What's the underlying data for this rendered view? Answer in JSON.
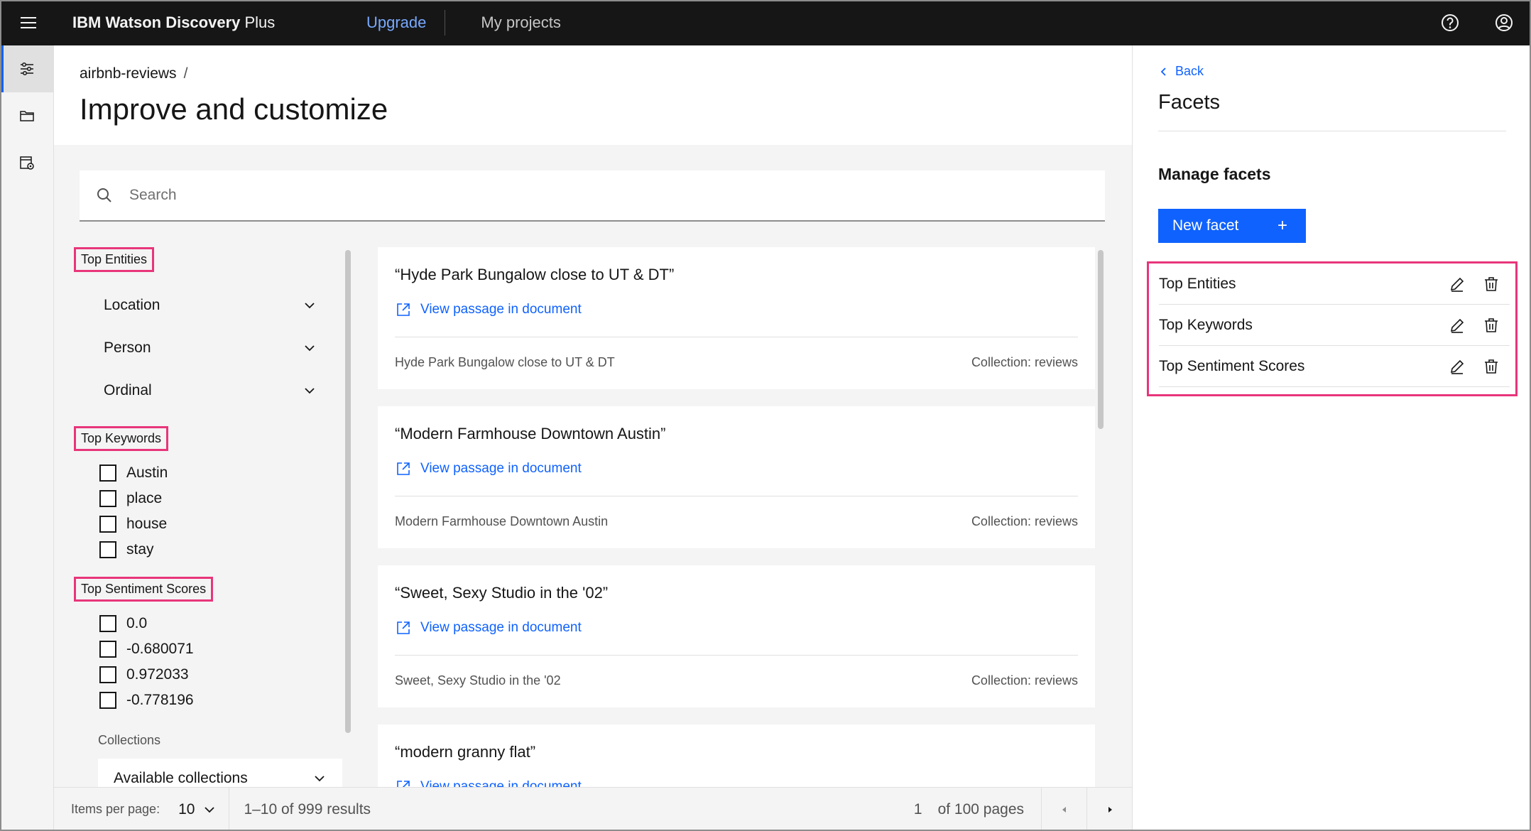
{
  "header": {
    "brand_bold": "IBM",
    "brand_rest": "Watson Discovery",
    "brand_plan": "Plus",
    "upgrade": "Upgrade",
    "my_projects": "My projects"
  },
  "page": {
    "breadcrumb": "airbnb-reviews",
    "breadcrumb_sep": "/",
    "title": "Improve and customize"
  },
  "search": {
    "placeholder": "Search"
  },
  "facets": {
    "top_entities": {
      "heading": "Top Entities",
      "dropdowns": [
        "Location",
        "Person",
        "Ordinal"
      ]
    },
    "top_keywords": {
      "heading": "Top Keywords",
      "options": [
        "Austin",
        "place",
        "house",
        "stay"
      ]
    },
    "top_sentiment": {
      "heading": "Top Sentiment Scores",
      "options": [
        "0.0",
        "-0.680071",
        "0.972033",
        "-0.778196"
      ]
    },
    "collections": {
      "label": "Collections",
      "select": "Available collections"
    }
  },
  "results": [
    {
      "title": "“Hyde Park Bungalow close to UT & DT”",
      "link": "View passage in document",
      "snippet": "Hyde Park Bungalow close to UT & DT",
      "collection": "Collection: reviews"
    },
    {
      "title": "“Modern Farmhouse Downtown Austin”",
      "link": "View passage in document",
      "snippet": "Modern Farmhouse Downtown Austin",
      "collection": "Collection: reviews"
    },
    {
      "title": "“Sweet, Sexy Studio in the '02”",
      "link": "View passage in document",
      "snippet": "Sweet, Sexy Studio in the '02",
      "collection": "Collection: reviews"
    },
    {
      "title": "“modern granny flat”",
      "link": "View passage in document",
      "snippet": "",
      "collection": ""
    }
  ],
  "pagination": {
    "items_label": "Items per page:",
    "items_value": "10",
    "range": "1–10 of 999 results",
    "page": "1",
    "of_pages": "of 100 pages"
  },
  "panel": {
    "back": "Back",
    "title": "Facets",
    "manage": "Manage facets",
    "new_facet": "New facet",
    "new_facet_plus": "+",
    "facet_rows": [
      "Top Entities",
      "Top Keywords",
      "Top Sentiment Scores"
    ]
  },
  "colors": {
    "accent": "#0f62fe",
    "highlight": "#e8357a",
    "header_bg": "#161616"
  }
}
